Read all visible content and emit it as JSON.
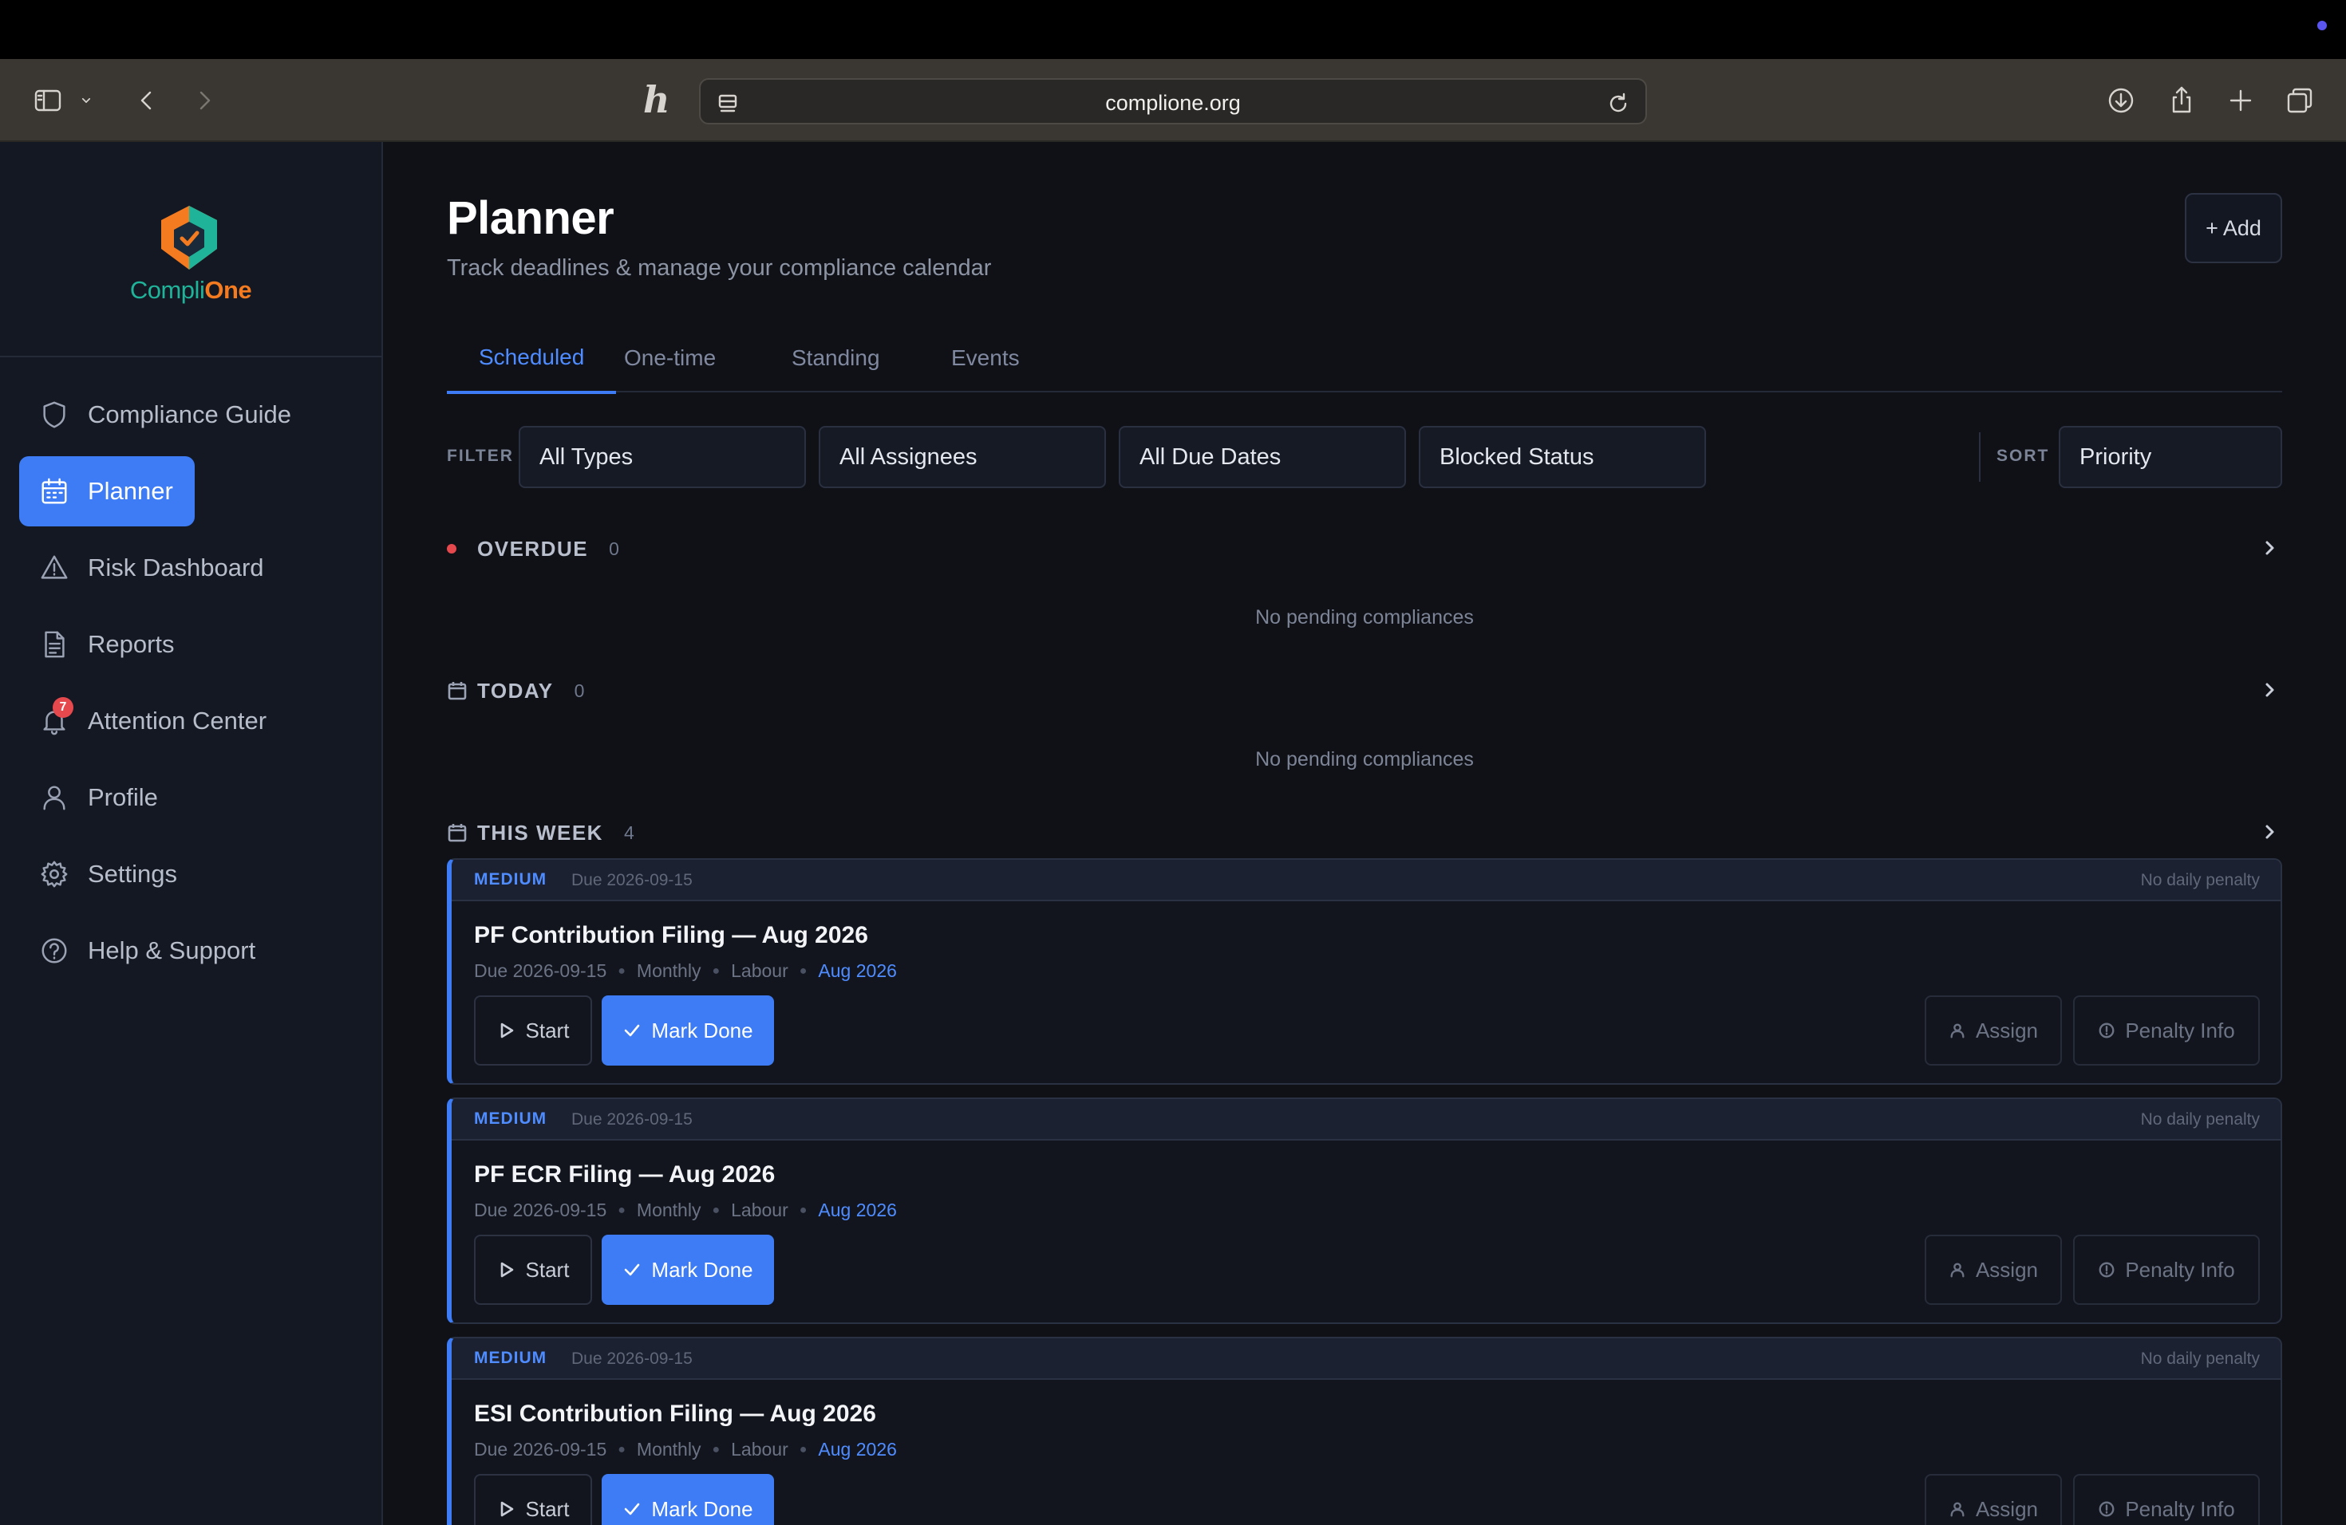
{
  "browser": {
    "url": "complione.org"
  },
  "brand": {
    "name_part1": "Compli",
    "name_part2": "One"
  },
  "sidebar": {
    "items": [
      {
        "label": "Compliance Guide",
        "icon": "shield-icon"
      },
      {
        "label": "Planner",
        "icon": "calendar-icon",
        "active": true
      },
      {
        "label": "Risk Dashboard",
        "icon": "warning-icon"
      },
      {
        "label": "Reports",
        "icon": "document-icon"
      },
      {
        "label": "Attention Center",
        "icon": "bell-icon",
        "badge": "7"
      },
      {
        "label": "Profile",
        "icon": "user-icon"
      },
      {
        "label": "Settings",
        "icon": "gear-icon"
      },
      {
        "label": "Help & Support",
        "icon": "help-icon"
      }
    ]
  },
  "page": {
    "title": "Planner",
    "subtitle": "Track deadlines & manage your compliance calendar",
    "add_label": "+ Add"
  },
  "tabs": [
    {
      "label": "Scheduled",
      "active": true
    },
    {
      "label": "One-time"
    },
    {
      "label": "Standing"
    },
    {
      "label": "Events"
    }
  ],
  "filters": {
    "filter_label": "FILTER",
    "type": "All Types",
    "assignee": "All Assignees",
    "due": "All Due Dates",
    "status": "Blocked Status",
    "sort_label": "SORT",
    "sort": "Priority"
  },
  "sections": {
    "overdue": {
      "title": "OVERDUE",
      "count": "0",
      "empty": "No pending compliances"
    },
    "today": {
      "title": "TODAY",
      "count": "0",
      "empty": "No pending compliances"
    },
    "week": {
      "title": "THIS WEEK",
      "count": "4"
    }
  },
  "cards": [
    {
      "priority": "MEDIUM",
      "due_top": "Due 2026-09-15",
      "penalty": "No daily penalty",
      "title": "PF Contribution Filing — Aug 2026",
      "due": "Due 2026-09-15",
      "freq": "Monthly",
      "category": "Labour",
      "period": "Aug 2026",
      "start": "Start",
      "done": "Mark Done",
      "assign": "Assign",
      "penalty_info": "Penalty Info"
    },
    {
      "priority": "MEDIUM",
      "due_top": "Due 2026-09-15",
      "penalty": "No daily penalty",
      "title": "PF ECR Filing — Aug 2026",
      "due": "Due 2026-09-15",
      "freq": "Monthly",
      "category": "Labour",
      "period": "Aug 2026",
      "start": "Start",
      "done": "Mark Done",
      "assign": "Assign",
      "penalty_info": "Penalty Info"
    },
    {
      "priority": "MEDIUM",
      "due_top": "Due 2026-09-15",
      "penalty": "No daily penalty",
      "title": "ESI Contribution Filing — Aug 2026",
      "due": "Due 2026-09-15",
      "freq": "Monthly",
      "category": "Labour",
      "period": "Aug 2026",
      "start": "Start",
      "done": "Mark Done",
      "assign": "Assign",
      "penalty_info": "Penalty Info"
    }
  ],
  "colors": {
    "accent": "#3d7cf4",
    "overdue_dot": "#e5484d",
    "brand_green": "#1fb39a",
    "brand_orange": "#f47b20"
  }
}
